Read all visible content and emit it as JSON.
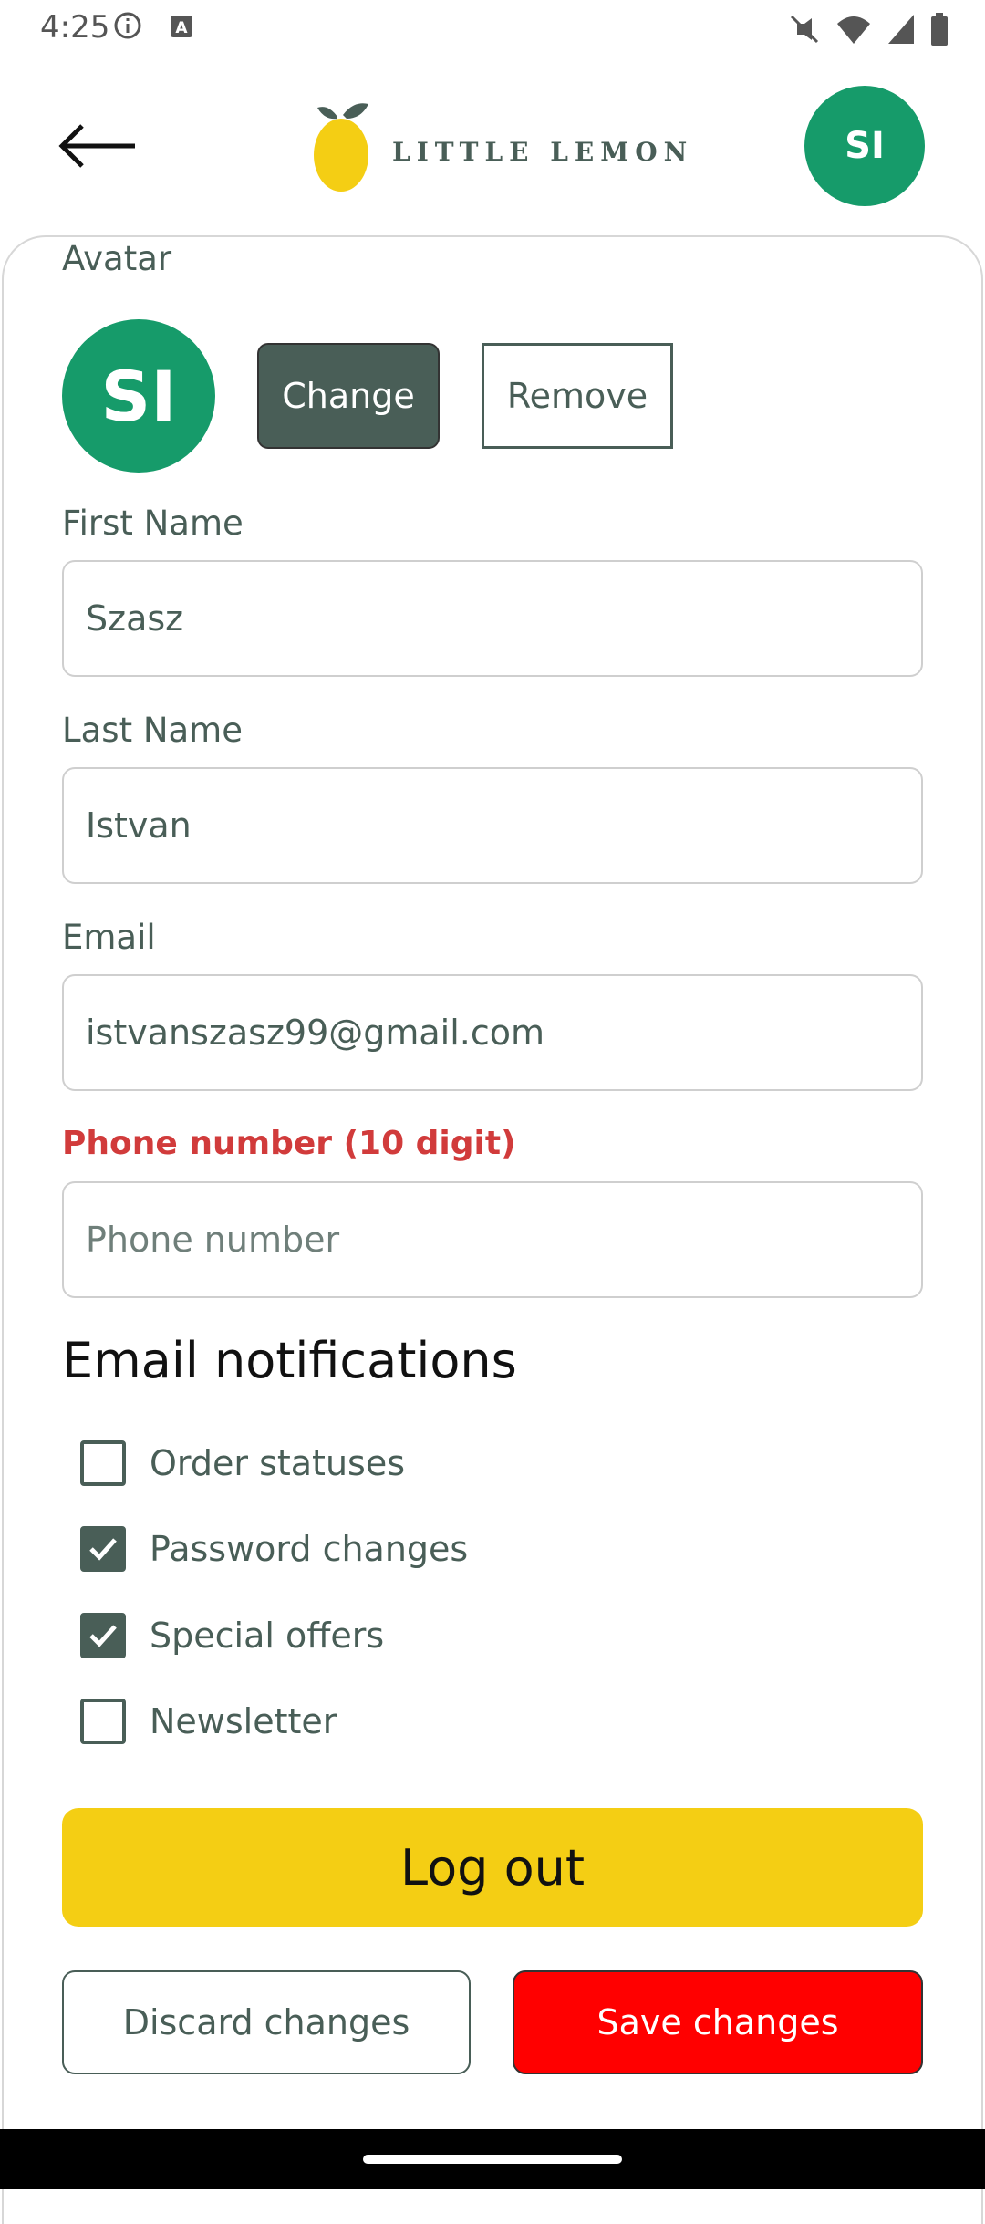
{
  "status_bar": {
    "time": "4:25",
    "icons": [
      "info-icon",
      "font-a-icon",
      "mute-vibrate-icon",
      "wifi-icon",
      "signal-icon",
      "battery-icon"
    ]
  },
  "header": {
    "logo_text": "LITTLE LEMON",
    "avatar_initials": "SI",
    "back_icon": "arrow-left-icon"
  },
  "profile": {
    "avatar_label": "Avatar",
    "avatar_initials": "SI",
    "change_label": "Change",
    "remove_label": "Remove",
    "first_name_label": "First Name",
    "first_name_value": "Szasz",
    "last_name_label": "Last Name",
    "last_name_value": "Istvan",
    "email_label": "Email",
    "email_value": "istvanszasz99@gmail.com",
    "phone_label": "Phone number (10 digit)",
    "phone_placeholder": "Phone number"
  },
  "notifications": {
    "title": "Email notifications",
    "items": [
      {
        "label": "Order statuses",
        "checked": false
      },
      {
        "label": "Password changes",
        "checked": true
      },
      {
        "label": "Special offers",
        "checked": true
      },
      {
        "label": "Newsletter",
        "checked": false
      }
    ]
  },
  "actions": {
    "logout": "Log out",
    "discard": "Discard changes",
    "save": "Save changes"
  },
  "colors": {
    "primary": "#495e57",
    "accent_yellow": "#f4ce14",
    "avatar_green": "#169b6a",
    "error": "#d13b3b",
    "save_red": "#ff0000"
  }
}
